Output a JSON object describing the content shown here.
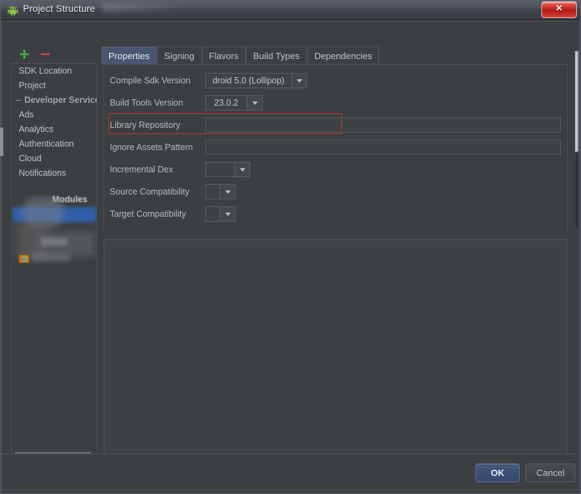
{
  "window": {
    "title": "Project Structure",
    "icon": "android-robot-icon",
    "close_label": "✕"
  },
  "sidebar": {
    "toolbar": {
      "add_label": "+",
      "remove_label": "−"
    },
    "items": [
      {
        "label": "SDK Location",
        "type": "item"
      },
      {
        "label": "Project",
        "type": "item"
      },
      {
        "label": "Developer Services",
        "type": "group"
      },
      {
        "label": "Ads",
        "type": "item"
      },
      {
        "label": "Analytics",
        "type": "item"
      },
      {
        "label": "Authentication",
        "type": "item"
      },
      {
        "label": "Cloud",
        "type": "item"
      },
      {
        "label": "Notifications",
        "type": "item"
      }
    ],
    "modules_group_label": "Modules"
  },
  "tabs": [
    {
      "label": "Properties",
      "active": true
    },
    {
      "label": "Signing",
      "active": false
    },
    {
      "label": "Flavors",
      "active": false
    },
    {
      "label": "Build Types",
      "active": false
    },
    {
      "label": "Dependencies",
      "active": false
    }
  ],
  "form": {
    "rows": [
      {
        "label": "Compile Sdk Version",
        "value": "droid 5.0 (Lollipop)",
        "control": "combo"
      },
      {
        "label": "Build Tools Version",
        "value": "23.0.2",
        "control": "combo"
      },
      {
        "label": "Library Repository",
        "value": "",
        "control": "text"
      },
      {
        "label": "Ignore Assets Pattern",
        "value": "",
        "control": "text"
      },
      {
        "label": "Incremental Dex",
        "value": "",
        "control": "combo"
      },
      {
        "label": "Source Compatibility",
        "value": "",
        "control": "combo"
      },
      {
        "label": "Target Compatibility",
        "value": "",
        "control": "combo"
      }
    ]
  },
  "footer": {
    "ok_label": "OK",
    "cancel_label": "Cancel"
  },
  "colors": {
    "dialog_bg": "#3c3f41",
    "accent_tab": "#4a5571",
    "highlight_border": "#c0392b",
    "ok_button": "#3a4c70",
    "add_icon": "#4caf50",
    "remove_icon": "#c9534f",
    "selection": "#2f5fa8"
  }
}
